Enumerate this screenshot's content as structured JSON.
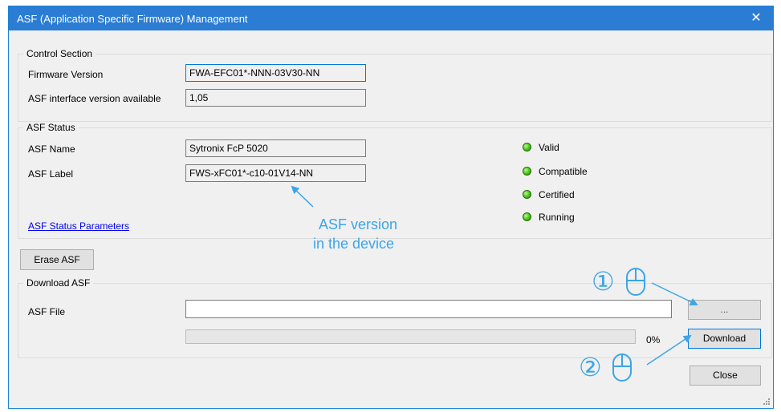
{
  "window": {
    "title": "ASF (Application Specific Firmware) Management",
    "close_glyph": "✕"
  },
  "control_section": {
    "legend": "Control Section",
    "firmware_version_label": "Firmware Version",
    "firmware_version_value": "FWA-EFC01*-NNN-03V30-NN",
    "interface_version_label": "ASF interface version available",
    "interface_version_value": "1,05"
  },
  "asf_status": {
    "legend": "ASF Status",
    "name_label": "ASF Name",
    "name_value": "Sytronix FcP 5020",
    "label_label": "ASF Label",
    "label_value": "FWS-xFC01*-c10-01V14-NN",
    "parameters_link": "ASF Status Parameters",
    "indicators": [
      {
        "label": "Valid",
        "color": "#52d21d"
      },
      {
        "label": "Compatible",
        "color": "#52d21d"
      },
      {
        "label": "Certified",
        "color": "#52d21d"
      },
      {
        "label": "Running",
        "color": "#52d21d"
      }
    ]
  },
  "erase_button": "Erase ASF",
  "download": {
    "legend": "Download ASF",
    "file_label": "ASF File",
    "file_value": "",
    "browse_button": "...",
    "progress_percent": 0,
    "progress_text": "0%",
    "download_button": "Download"
  },
  "close_button": "Close",
  "annotations": {
    "version_note_line1": "ASF version",
    "version_note_line2": "in the device",
    "step1": "①",
    "step2": "②",
    "color": "#3ca5e6"
  }
}
